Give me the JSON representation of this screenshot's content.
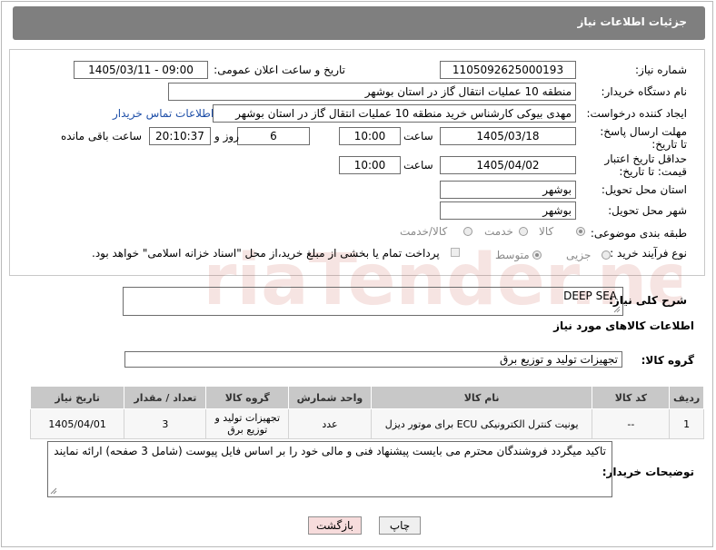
{
  "header": {
    "title": "جزئیات اطلاعات نیاز"
  },
  "fields": {
    "need_number_label": "شماره نیاز:",
    "need_number": "1105092625000193",
    "announce_label": "تاریخ و ساعت اعلان عمومی:",
    "announce_value": "1405/03/11 - 09:00",
    "buyer_org_label": "نام دستگاه خریدار:",
    "buyer_org": "منطقه 10 عملیات انتقال گاز در استان بوشهر",
    "requester_label": "ایجاد کننده درخواست:",
    "requester": "مهدی بیوکی کارشناس خرید منطقه 10 عملیات انتقال گاز در استان بوشهر",
    "buyer_contact_link": "اطلاعات تماس خریدار",
    "deadline_label": "مهلت ارسال پاسخ: تا تاریخ:",
    "deadline_date": "1405/03/18",
    "time_label": "ساعت",
    "deadline_time": "10:00",
    "days_value": "6",
    "days_label": "روز و",
    "remaining_time": "20:10:37",
    "remaining_label": "ساعت باقی مانده",
    "validity_label": "حداقل تاریخ اعتبار قیمت: تا تاریخ:",
    "validity_date": "1405/04/02",
    "validity_time": "10:00",
    "province_label": "استان محل تحویل:",
    "province": "بوشهر",
    "city_label": "شهر محل تحویل:",
    "city": "بوشهر",
    "category_label": "طبقه بندی موضوعی:",
    "category_options": [
      "کالا",
      "خدمت",
      "کالا/خدمت"
    ],
    "process_label": "نوع فرآیند خرید :",
    "process_options": [
      "جزیی",
      "متوسط"
    ],
    "payment_note": "پرداخت تمام یا بخشی از مبلغ خرید،از محل \"اسناد خزانه اسلامی\" خواهد بود."
  },
  "description": {
    "label": "شرح کلی نیاز:",
    "value": "DEEP SEA"
  },
  "goods_info": {
    "title": "اطلاعات کالاهای مورد نیاز",
    "group_label": "گروه کالا:",
    "group_value": "تجهیزات تولید و توزیع برق"
  },
  "table": {
    "headers": [
      "ردیف",
      "کد کالا",
      "نام کالا",
      "واحد شمارش",
      "گروه کالا",
      "تعداد / مقدار",
      "تاریخ نیاز"
    ],
    "rows": [
      [
        "1",
        "--",
        "یونیت کنترل الکترونیکی ECU برای موتور دیزل",
        "عدد",
        "تجهیزات تولید و توزیع برق",
        "3",
        "1405/04/01"
      ]
    ]
  },
  "notes": {
    "label": "توضیحات خریدار:",
    "value": "تاکید میگردد فروشندگان محترم می بایست پیشنهاد فنی و مالی خود را بر اساس فایل پیوست (شامل 3 صفحه) ارائه نمایند"
  },
  "buttons": {
    "print": "چاپ",
    "back": "بازگشت"
  },
  "watermark": {
    "text": "AriaTender.neT"
  },
  "colors": {
    "header_bg": "#7f7f7f",
    "link": "#1e4fa8",
    "back_button_bg": "#f7dcdc"
  }
}
